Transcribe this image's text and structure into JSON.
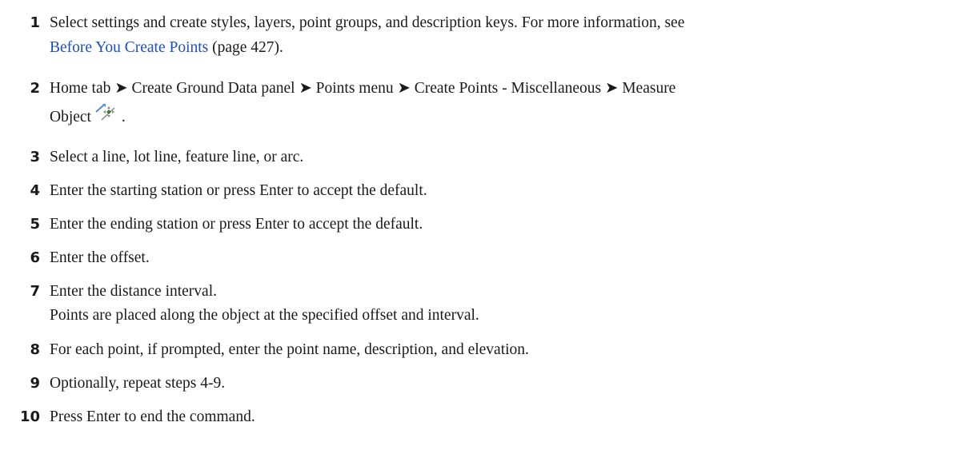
{
  "steps": [
    {
      "number": "1",
      "text": "Select settings and create styles, layers, point groups, and description keys. For more information, see",
      "link_text": "Before You Create Points",
      "after_link": " (page 427)."
    },
    {
      "number": "2",
      "text": "Home tab ➤ Create Ground Data panel ➤ Points menu ➤ Create Points - Miscellaneous ➤ Measure",
      "line2": "Object",
      "icon": "measure-object-icon",
      "after_icon": " ."
    },
    {
      "number": "3",
      "text": "Select a line, lot line, feature line, or arc."
    },
    {
      "number": "4",
      "text": "Enter the starting station or press Enter to accept the default."
    },
    {
      "number": "5",
      "text": "Enter the ending station or press Enter to accept the default."
    },
    {
      "number": "6",
      "text": "Enter the offset."
    },
    {
      "number": "7",
      "text": "Enter the distance interval.",
      "result": "Points are placed along the object at the specified offset and interval."
    },
    {
      "number": "8",
      "text": "For each point, if prompted, enter the point name, description, and elevation."
    },
    {
      "number": "9",
      "text": "Optionally, repeat steps 4-9."
    },
    {
      "number": "10",
      "text": "Press Enter to end the command."
    }
  ],
  "colors": {
    "text": "#1a1a1a",
    "link": "#1d4fc4"
  }
}
